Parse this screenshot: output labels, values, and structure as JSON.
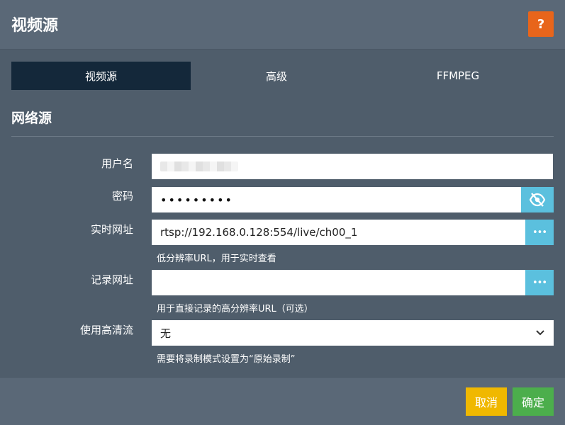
{
  "dialog": {
    "title": "视频源",
    "help_label": "?"
  },
  "tabs": [
    {
      "label": "视频源",
      "active": true
    },
    {
      "label": "高级",
      "active": false
    },
    {
      "label": "FFMPEG",
      "active": false
    }
  ],
  "section": {
    "title": "网络源"
  },
  "form": {
    "username": {
      "label": "用户名",
      "value": ""
    },
    "password": {
      "label": "密码",
      "value": "•••••••••"
    },
    "live_url": {
      "label": "实时网址",
      "value": "rtsp://192.168.0.128:554/live/ch00_1",
      "hint": "低分辨率URL，用于实时查看",
      "button": "•••"
    },
    "record_url": {
      "label": "记录网址",
      "value": "",
      "hint": "用于直接记录的高分辨率URL（可选）",
      "button": "•••"
    },
    "hd_stream": {
      "label": "使用高清流",
      "value": "无",
      "hint": "需要将录制模式设置为“原始录制”"
    }
  },
  "footer": {
    "cancel_label": "取消",
    "ok_label": "确定"
  },
  "colors": {
    "accent_orange": "#e8651b",
    "tab_active": "#14283a",
    "info_blue": "#5bc0de",
    "warning": "#f0b800",
    "success": "#4cae4c"
  }
}
